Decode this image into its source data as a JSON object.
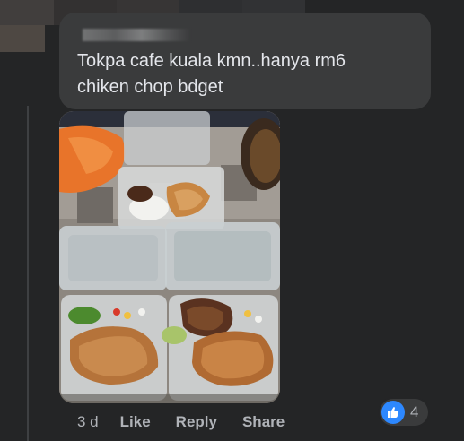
{
  "comment": {
    "text_line1": "Tokpa cafe kuala kmn..hanya rm6",
    "text_line2": "chiken chop bdget"
  },
  "photo": {
    "description_icon": "food-photo"
  },
  "actions": {
    "time": "3 d",
    "like_label": "Like",
    "reply_label": "Reply",
    "share_label": "Share"
  },
  "reactions": {
    "count": "4",
    "icon": "thumbs-up-icon",
    "color": "#2d88ff"
  },
  "colors": {
    "background": "#242526",
    "bubble": "#3a3b3c",
    "text": "#e4e6eb",
    "secondary_text": "#b0b3b8"
  }
}
